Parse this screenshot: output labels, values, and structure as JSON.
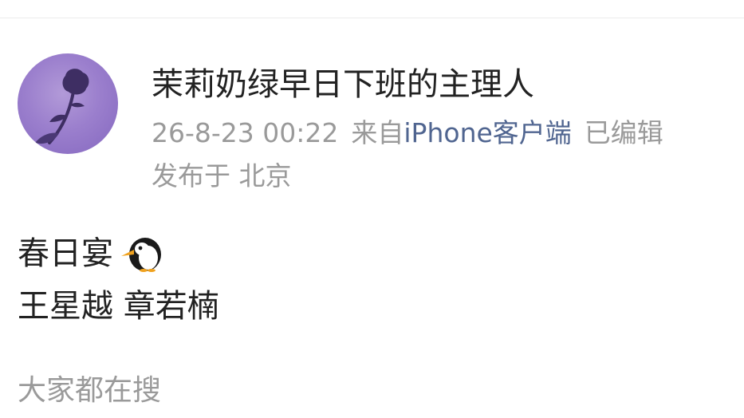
{
  "post": {
    "author": {
      "name": "茉莉奶绿早日下班的主理人",
      "avatar_icon": "rose-silhouette-avatar"
    },
    "meta": {
      "timestamp": "26-8-23 00:22",
      "source_prefix": "来自",
      "client": "iPhone客户端",
      "edited": "已编辑",
      "location": "发布于 北京"
    },
    "body": {
      "line1": "春日宴",
      "line1_emoji": "penguin-icon",
      "line2": "王星越 章若楠"
    }
  },
  "footer": {
    "label": "大家都在搜"
  },
  "colors": {
    "text_primary": "#222222",
    "text_secondary": "#9a9a9a",
    "link": "#506590",
    "avatar_bg": "#9b7fcd"
  }
}
